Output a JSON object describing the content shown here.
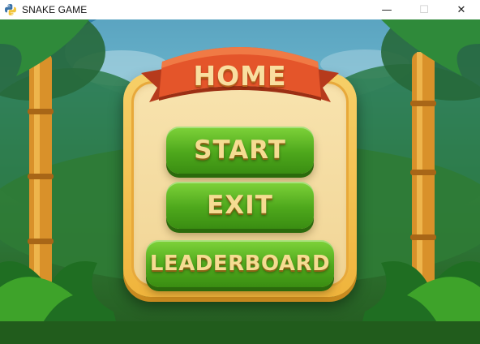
{
  "window": {
    "title": "SNAKE GAME",
    "icon": "python-icon",
    "controls": [
      "minimize",
      "maximize",
      "close"
    ],
    "control_glyphs": {
      "minimize": "—",
      "maximize": "☐",
      "close": "✕"
    }
  },
  "menu": {
    "header": "HOME",
    "buttons": [
      {
        "id": "start",
        "label": "START"
      },
      {
        "id": "exit",
        "label": "EXIT"
      },
      {
        "id": "leaderboard",
        "label": "LEADERBOARD"
      }
    ]
  },
  "colors": {
    "ribbon": "#e4552a",
    "button_green": "#4ea81c",
    "panel_gold": "#f0b43c",
    "label_cream": "#f5dc92"
  }
}
